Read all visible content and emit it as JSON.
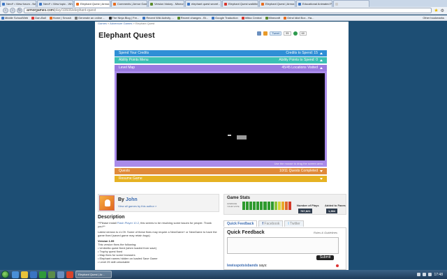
{
  "browser": {
    "tabs": [
      {
        "label": "Nerd* • View forum - Ne...",
        "color": "#3a74c2",
        "active": false
      },
      {
        "label": "Nerd* • View topic - Wh...",
        "color": "#3a74c2",
        "active": false
      },
      {
        "label": "Elephant Quest | Armor...",
        "color": "#e86a1a",
        "active": true
      },
      {
        "label": "Comments | Armor Gam...",
        "color": "#e86a1a",
        "active": false
      },
      {
        "label": "Version history - Minecr...",
        "color": "#5a8a2a",
        "active": false
      },
      {
        "label": "elephant quest secret - R...",
        "color": "#3a74c2",
        "active": false
      },
      {
        "label": "Elephant Quest walkthro...",
        "color": "#d8332a",
        "active": false
      },
      {
        "label": "Elephant Quest | Armor...",
        "color": "#e86a1a",
        "active": false
      },
      {
        "label": "Educational Animated Fi...",
        "color": "#3a74c2",
        "active": false
      },
      {
        "label": "",
        "color": "#cccccc",
        "active": false
      }
    ],
    "url_host": "armorgames.com",
    "url_path": "/play/10606/elephant-quest",
    "bookmarks": [
      {
        "label": "Middle SchoolWeb",
        "color": "#3a74c2"
      },
      {
        "label": "Dan-Ball",
        "color": "#d33"
      },
      {
        "label": "Home | Smosh",
        "color": "#e86a1a"
      },
      {
        "label": "Generate an online ...",
        "color": "#777"
      },
      {
        "label": "The Ninja Blog | Fre...",
        "color": "#333"
      },
      {
        "label": "Recent Wiki Activity ...",
        "color": "#3a74c2"
      },
      {
        "label": "Recent changes - Bl...",
        "color": "#5a8a2a"
      },
      {
        "label": "Google Traduction",
        "color": "#3a74c2"
      },
      {
        "label": "Wikia Central",
        "color": "#d8332a"
      },
      {
        "label": "Minecraft",
        "color": "#5a8a2a"
      },
      {
        "label": "Grind Idiot Box - Ha...",
        "color": "#e86a1a"
      }
    ],
    "other_bookmarks": "Other bookmarks"
  },
  "page": {
    "breadcrumb": {
      "games": "Games",
      "adventure": "Adventure Games",
      "current": "Elephant Quest"
    },
    "title": "Elephant Quest",
    "share": {
      "tweet": "Tweet",
      "tweet_count": "95",
      "like_count": "60"
    },
    "game": {
      "credits": {
        "label": "Spend Your Credits",
        "right": "Credits to Spend: 15"
      },
      "ability": {
        "label": "Ability Points Menu",
        "right": "Ability Points to Spend: 0"
      },
      "level": {
        "label": "Level Map",
        "right": "45/45 Locations Visited"
      },
      "map_hint": "Use the mouse to drag the screen area",
      "quests": {
        "label": "Quests",
        "right": "10/11 Quests Completed"
      },
      "resume": {
        "label": "Resume Game"
      }
    },
    "author": {
      "by": "By",
      "name": "John",
      "link": "View all games by this author »"
    },
    "description": {
      "heading": "Description",
      "p1_pre": "**Please install ",
      "p1_link": "Flash Player 10.2",
      "p1_post": ", this seems to be resolving some issues for people. Thank you!**",
      "p2": "Latest version is v1.09. Some of these fixes may require a NewGame+ or NewGame to have the game fixed (saved game may retain bugs)",
      "version": "Version 1.09",
      "fixes_intro": "This version fixes the following:",
      "fixes": [
        "• Umbrella quest fixed (when loaded from save)",
        "• Trophy quest fixed",
        "• Map fixes for some browsers",
        "• Elephant names hidden on loaded Save Game",
        "• Level 25 skill unlockable"
      ]
    },
    "stats": {
      "heading": "Game Stats",
      "rate_top": "AVERAGE",
      "rate_bottom": "YOUR VOTE",
      "plays_label": "Number of Plays",
      "plays_value": "787,821",
      "faves_label": "Added to Faves",
      "faves_value": "1,384",
      "rating_colors": [
        "#2e9a2e",
        "#2e9a2e",
        "#2e9a2e",
        "#2e9a2e",
        "#2e9a2e",
        "#2e9a2e",
        "#2e9a2e",
        "#2e9a2e",
        "#2e9a2e",
        "#8ac43a",
        "#d6d63a",
        "#e8a92a",
        "#e06a2a",
        "#d33a2a"
      ]
    },
    "feedback": {
      "tab_quick": "Quick Feedback",
      "tab_facebook": "Facebook",
      "tab_twitter": "Twitter",
      "heading": "Quick Feedback",
      "rules": "Rules & Guidelines",
      "submit": "Submit",
      "user": "lewisspotsisbands",
      "says": "says:"
    }
  },
  "taskbar": {
    "task_label": "Elephant Quest | Ar...",
    "clock": "17:48"
  }
}
